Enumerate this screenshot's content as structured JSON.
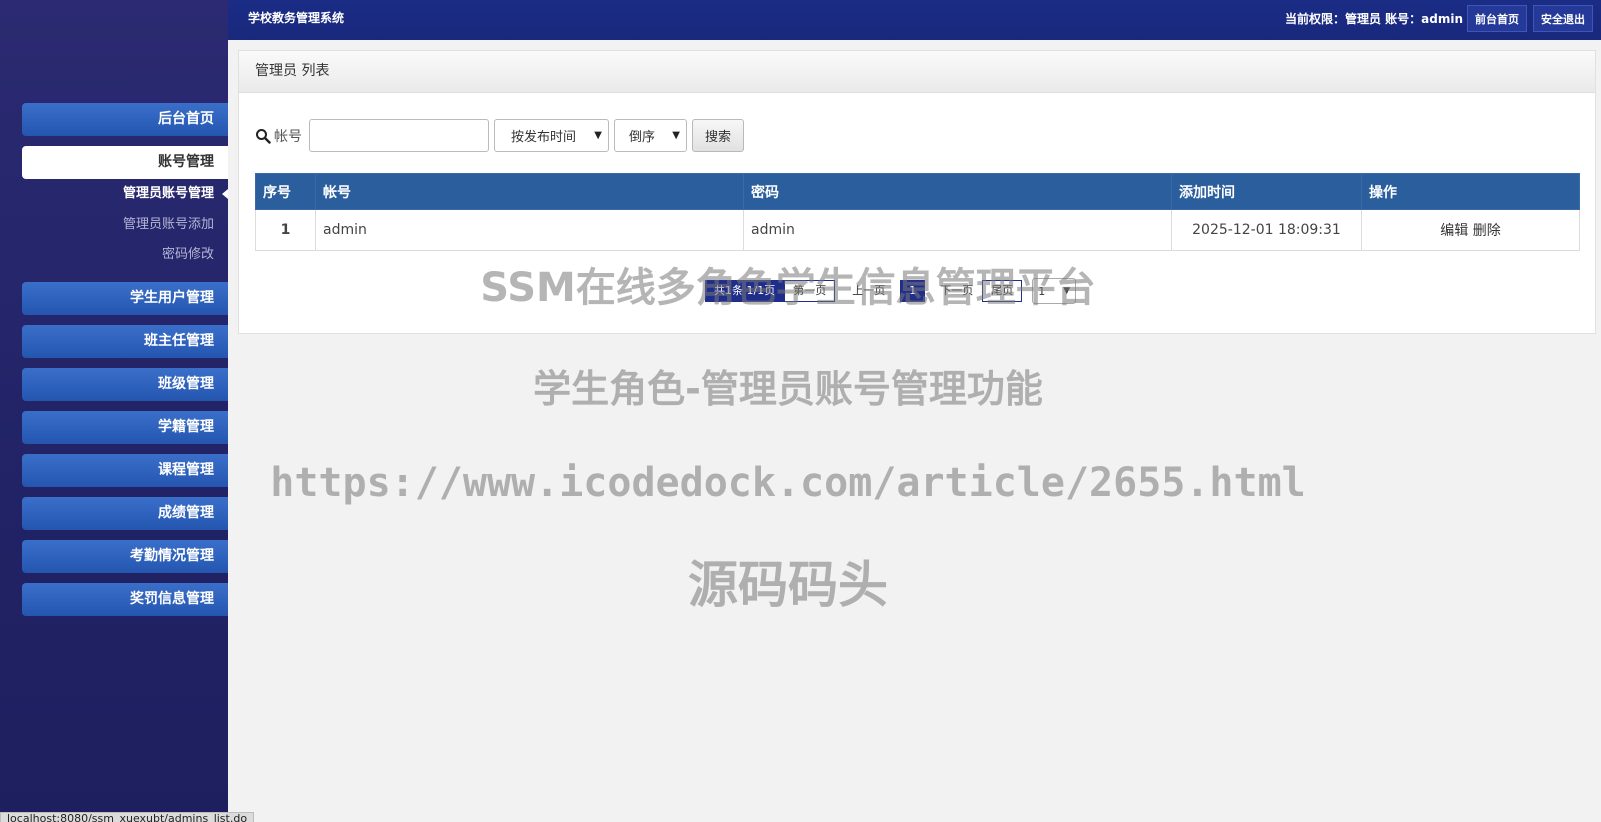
{
  "header": {
    "system_title": "学校教务管理系统",
    "permission_text": "当前权限：管理员 账号：admin",
    "front_home_label": "前台首页",
    "logout_label": "安全退出"
  },
  "sidebar": {
    "items": [
      {
        "label": "后台首页"
      },
      {
        "label": "账号管理"
      },
      {
        "label": "学生用户管理"
      },
      {
        "label": "班主任管理"
      },
      {
        "label": "班级管理"
      },
      {
        "label": "学籍管理"
      },
      {
        "label": "课程管理"
      },
      {
        "label": "成绩管理"
      },
      {
        "label": "考勤情况管理"
      },
      {
        "label": "奖罚信息管理"
      }
    ],
    "sub_items": [
      {
        "label": "管理员账号管理"
      },
      {
        "label": "管理员账号添加"
      },
      {
        "label": "密码修改"
      }
    ]
  },
  "panel": {
    "title": "管理员 列表"
  },
  "search": {
    "label": "帐号",
    "value": "",
    "sort_field": "按发布时间",
    "sort_order": "倒序",
    "button_label": "搜索"
  },
  "table": {
    "headers": [
      "序号",
      "帐号",
      "密码",
      "添加时间",
      "操作"
    ],
    "rows": [
      {
        "index": "1",
        "account": "admin",
        "password": "admin",
        "time": "2025-12-01 18:09:31",
        "edit": "编辑",
        "delete": "删除"
      }
    ]
  },
  "pager": {
    "info": "共1条 1/1页",
    "first": "第一页",
    "prev": "上一页",
    "current": "1",
    "next": "下一页",
    "last": "尾页",
    "select_value": "1"
  },
  "watermark": {
    "line1": "SSM在线多角色学生信息管理平台",
    "line2": "学生角色-管理员账号管理功能",
    "line3": "https://www.icodedock.com/article/2655.html",
    "line4": "源码码头"
  },
  "status_url": "localhost:8080/ssm_xuexubt/admins_list.do"
}
